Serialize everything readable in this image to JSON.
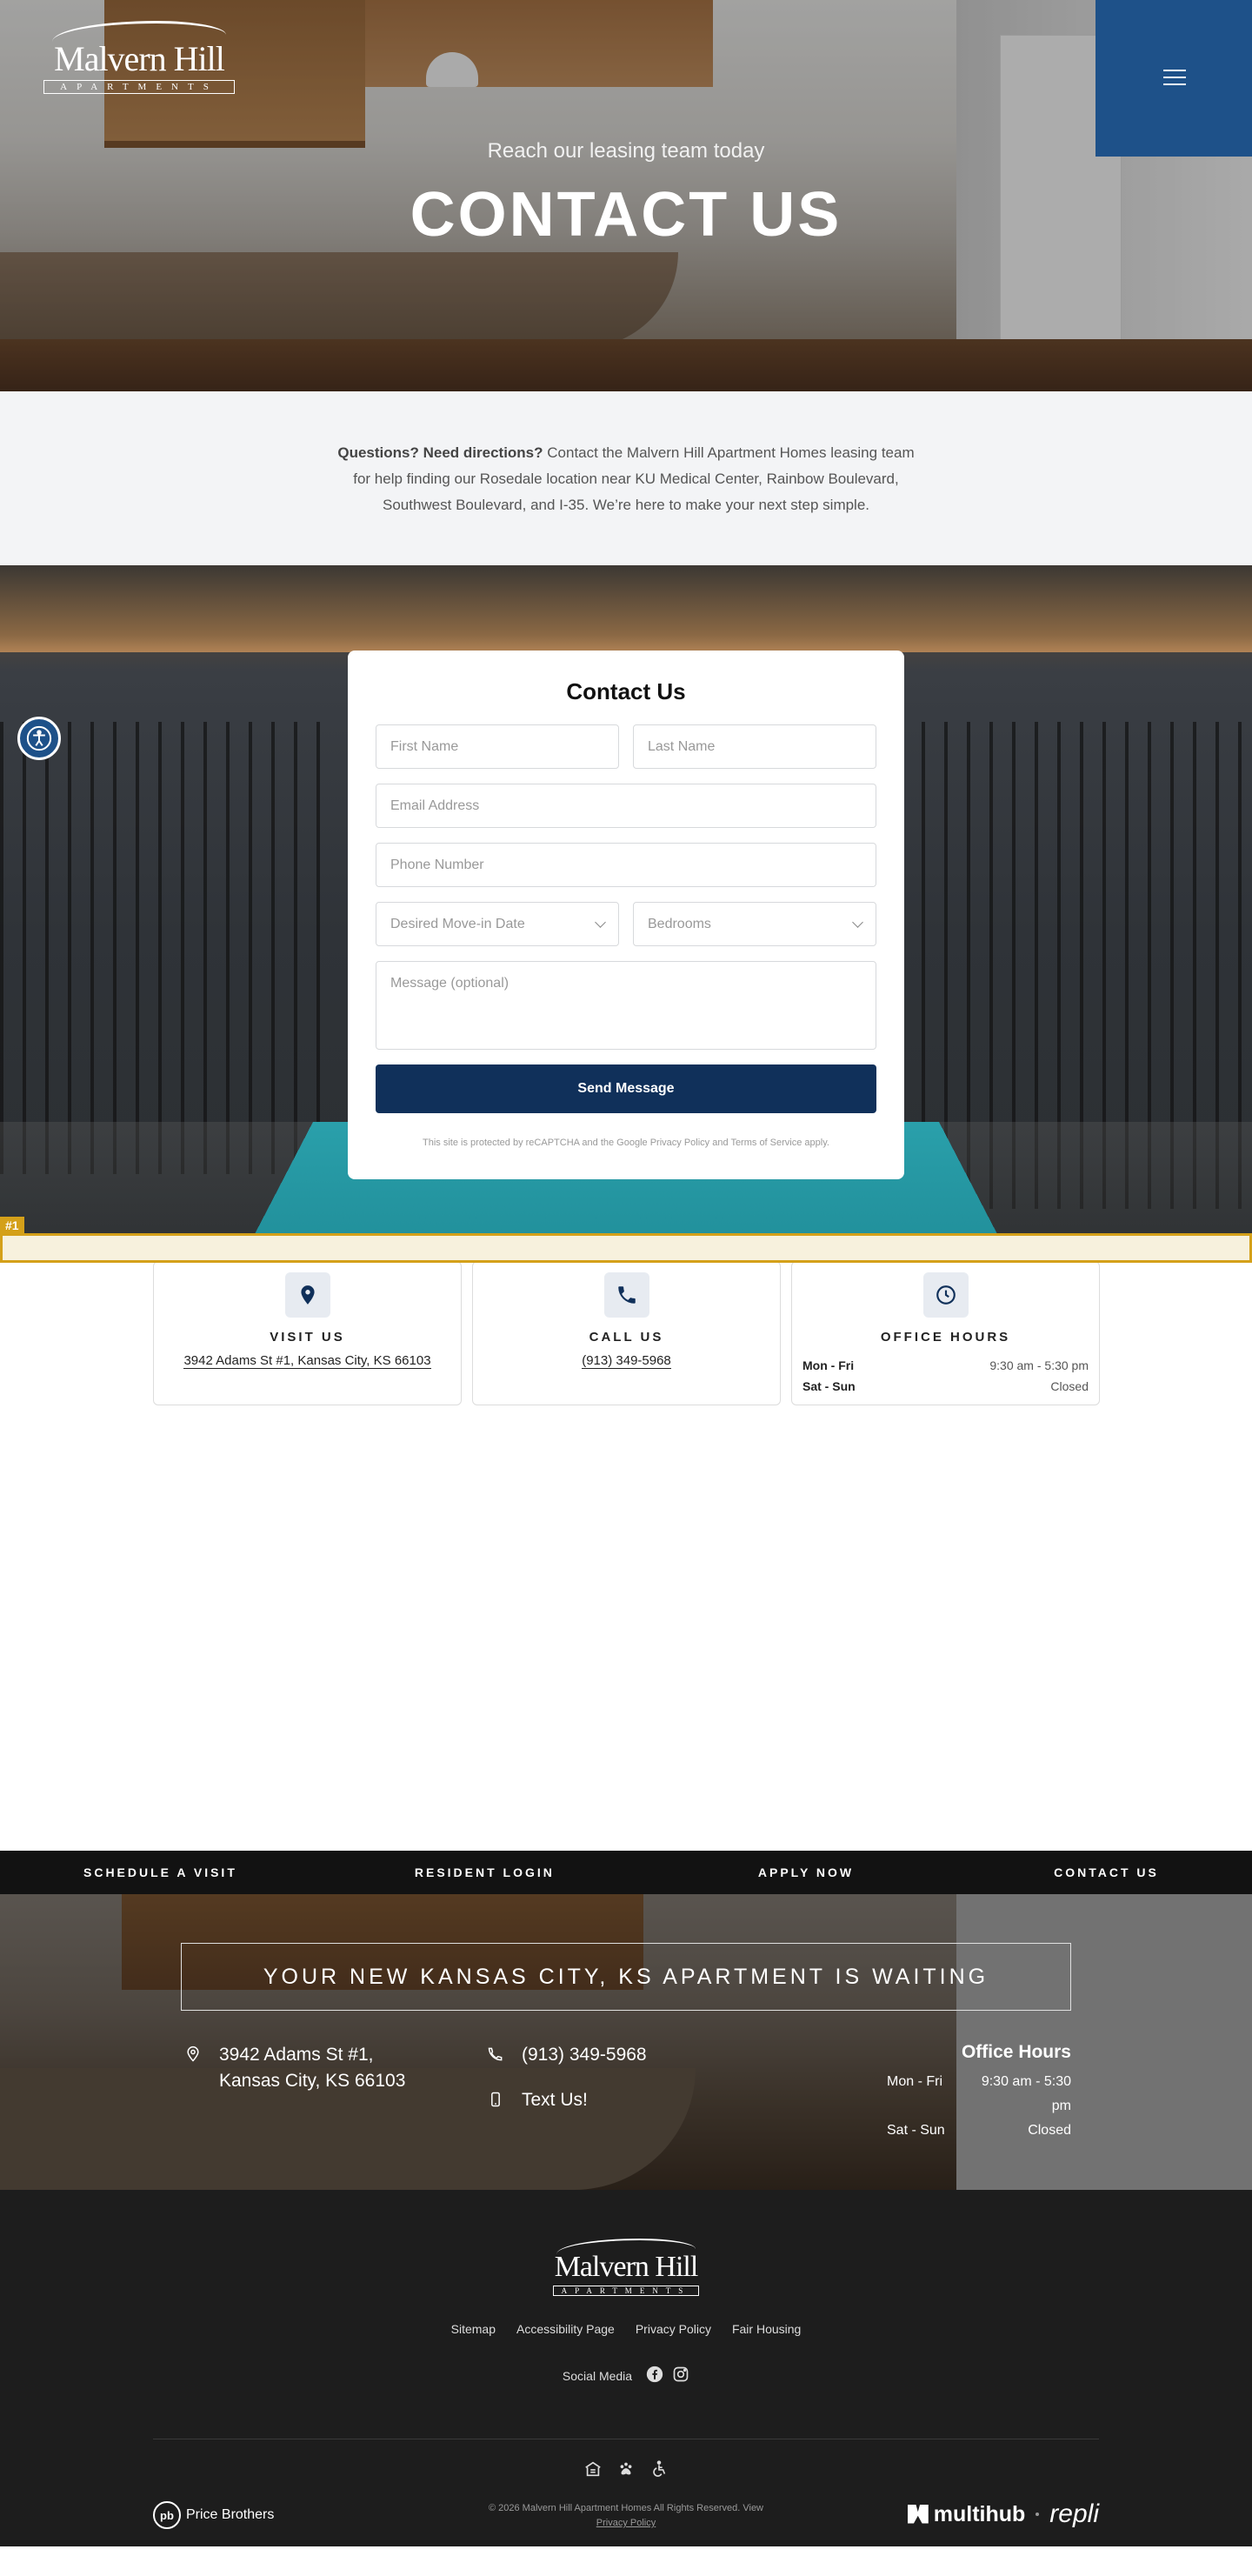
{
  "hero": {
    "logo_name": "Malvern Hill",
    "logo_sub": "APARTMENTS",
    "tagline": "Reach our leasing team today",
    "title": "CONTACT US",
    "menu_icon": "hamburger-icon"
  },
  "intro": {
    "lead": "Questions? Need directions?",
    "body": " Contact the Malvern Hill Apartment Homes leasing team for help finding our Rosedale location near KU Medical Center, Rainbow Boulevard, Southwest Boulevard, and I-35. We’re here to make your next step simple."
  },
  "form": {
    "title": "Contact Us",
    "first_name": "First Name",
    "last_name": "Last Name",
    "email": "Email Address",
    "phone": "Phone Number",
    "move_in": "Desired Move-in Date",
    "bedrooms": "Bedrooms",
    "message": "Message (optional)",
    "submit": "Send Message",
    "recaptcha": "This site is protected by reCAPTCHA and the Google Privacy Policy and Terms of Service apply."
  },
  "marker_label": "#1",
  "cards": {
    "visit": {
      "title": "VISIT US",
      "value": "3942 Adams St #1, Kansas City, KS 66103",
      "icon": "map-pin-icon"
    },
    "call": {
      "title": "CALL US",
      "value": "(913) 349-5968",
      "icon": "phone-icon"
    },
    "hours": {
      "title": "OFFICE HOURS",
      "icon": "clock-icon",
      "rows": [
        {
          "day": "Mon - Fri",
          "time": "9:30 am - 5:30 pm"
        },
        {
          "day": "Sat - Sun",
          "time": "Closed"
        }
      ]
    }
  },
  "navstrip": [
    "SCHEDULE A VISIT",
    "RESIDENT LOGIN",
    "APPLY NOW",
    "CONTACT US"
  ],
  "cta": {
    "headline": "YOUR NEW KANSAS CITY, KS APARTMENT IS WAITING",
    "address_line1": "3942 Adams St #1,",
    "address_line2": "Kansas City, KS 66103",
    "phone": "(913) 349-5968",
    "text": "Text Us!",
    "hours_title": "Office Hours",
    "hours": [
      {
        "day": "Mon - Fri",
        "time": "9:30 am - 5:30 pm"
      },
      {
        "day": "Sat - Sun",
        "time": "Closed"
      }
    ]
  },
  "footer": {
    "logo_name": "Malvern Hill",
    "logo_sub": "APARTMENTS",
    "links": [
      "Sitemap",
      "Accessibility Page",
      "Privacy Policy",
      "Fair Housing"
    ],
    "social_label": "Social Media",
    "copyright": "© 2026 Malvern Hill Apartment Homes All Rights Reserved. View",
    "privacy": "Privacy Policy",
    "price_brothers": "Price Brothers",
    "pb_mark": "pb",
    "multihub": "multihub",
    "repli": "repli"
  }
}
